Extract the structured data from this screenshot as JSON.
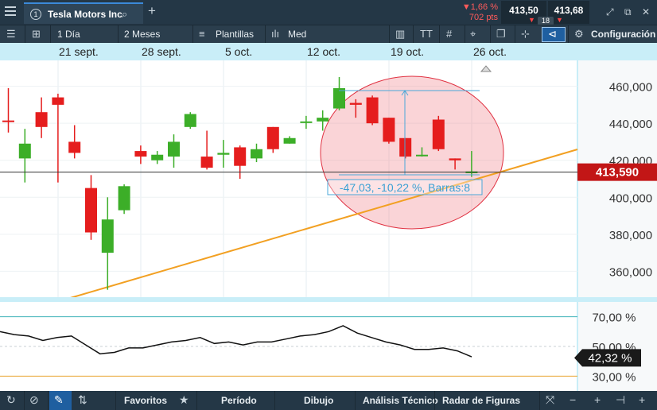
{
  "topbar": {
    "tab_number": "1",
    "instrument_title": "Tesla Motors Inc",
    "change_percent": "▼1,66 %",
    "change_points": "702 pts",
    "bid_price": "413,50",
    "ask_price": "413,68",
    "spread": "18",
    "accent_color": "#3b8ad9"
  },
  "toolbar": {
    "interval": "1 Día",
    "period": "2 Meses",
    "templates_label": "Plantillas",
    "chart_type_label": "Med",
    "settings_label": "Configuración"
  },
  "date_axis": [
    "21 sept.",
    "28 sept.",
    "5 oct.",
    "12 oct.",
    "19 oct.",
    "26 oct."
  ],
  "chart_data": {
    "type": "candlestick",
    "price_axis": {
      "ticks": [
        "460,000",
        "440,000",
        "420,000",
        "400,000",
        "380,000",
        "360,000"
      ],
      "tick_values": [
        460,
        440,
        420,
        400,
        380,
        360
      ],
      "range": [
        346,
        474
      ]
    },
    "current_price_label": "413,590",
    "current_price": 413.59,
    "measurement_label": "-47,03, -10,22 %, Barras:8",
    "up_color": "#3cae28",
    "down_color": "#e51d1d",
    "candles": [
      {
        "o": 441.5,
        "c": 441.0,
        "h": 459,
        "l": 435
      },
      {
        "o": 421,
        "c": 429,
        "h": 437,
        "l": 408
      },
      {
        "o": 446,
        "c": 438,
        "h": 454,
        "l": 432
      },
      {
        "o": 454,
        "c": 450,
        "h": 456,
        "l": 408
      },
      {
        "o": 430,
        "c": 424,
        "h": 439,
        "l": 421
      },
      {
        "o": 405,
        "c": 381,
        "h": 412,
        "l": 377
      },
      {
        "o": 370,
        "c": 388,
        "h": 400,
        "l": 350
      },
      {
        "o": 393,
        "c": 406,
        "h": 407,
        "l": 391
      },
      {
        "o": 425,
        "c": 422,
        "h": 428,
        "l": 418
      },
      {
        "o": 420,
        "c": 423,
        "h": 425,
        "l": 418
      },
      {
        "o": 422,
        "c": 430,
        "h": 434,
        "l": 416
      },
      {
        "o": 438,
        "c": 445,
        "h": 446,
        "l": 437
      },
      {
        "o": 422,
        "c": 416,
        "h": 436,
        "l": 415
      },
      {
        "o": 423,
        "c": 424,
        "h": 431,
        "l": 416
      },
      {
        "o": 427,
        "c": 417,
        "h": 428,
        "l": 410
      },
      {
        "o": 421,
        "c": 426,
        "h": 429,
        "l": 419
      },
      {
        "o": 438,
        "c": 426,
        "h": 438,
        "l": 424
      },
      {
        "o": 429,
        "c": 432,
        "h": 433,
        "l": 429
      },
      {
        "o": 441,
        "c": 441,
        "h": 444,
        "l": 437
      },
      {
        "o": 441,
        "c": 443,
        "h": 447,
        "l": 436
      },
      {
        "o": 448,
        "c": 459,
        "h": 465,
        "l": 447
      },
      {
        "o": 451,
        "c": 450,
        "h": 453,
        "l": 443
      },
      {
        "o": 454,
        "c": 440,
        "h": 455,
        "l": 439
      },
      {
        "o": 443,
        "c": 430,
        "h": 443,
        "l": 429
      },
      {
        "o": 432,
        "c": 422,
        "h": 432,
        "l": 421
      },
      {
        "o": 423,
        "c": 423,
        "h": 427,
        "l": 422
      },
      {
        "o": 442,
        "c": 426,
        "h": 444,
        "l": 425
      },
      {
        "o": 421,
        "c": 420,
        "h": 421,
        "l": 415
      },
      {
        "o": 413,
        "c": 414,
        "h": 425,
        "l": 411
      }
    ],
    "indicator": {
      "ticks": [
        "70,00 %",
        "50,00 %",
        "30,00 %"
      ],
      "tick_values": [
        70,
        50,
        30
      ],
      "range": [
        20,
        80
      ],
      "upper_level": 70,
      "lower_level": 30,
      "current_value_label": "42,32 %",
      "current_value": 42.32,
      "upper_level_color": "#3fb3b8",
      "lower_level_color": "#e8a32c",
      "values": [
        60,
        58,
        57,
        54,
        56,
        57,
        51,
        45,
        46,
        49,
        49,
        51,
        53,
        54,
        56,
        52,
        53,
        51,
        53,
        53,
        55,
        57,
        58,
        60,
        64,
        59,
        56,
        53,
        51,
        48,
        48,
        49,
        47,
        43
      ]
    }
  },
  "bottombar": {
    "favorites": "Favoritos",
    "period": "Período",
    "drawing": "Dibujo",
    "technical": "Análisis Técnico",
    "pattern_radar": "Radar de Figuras"
  }
}
